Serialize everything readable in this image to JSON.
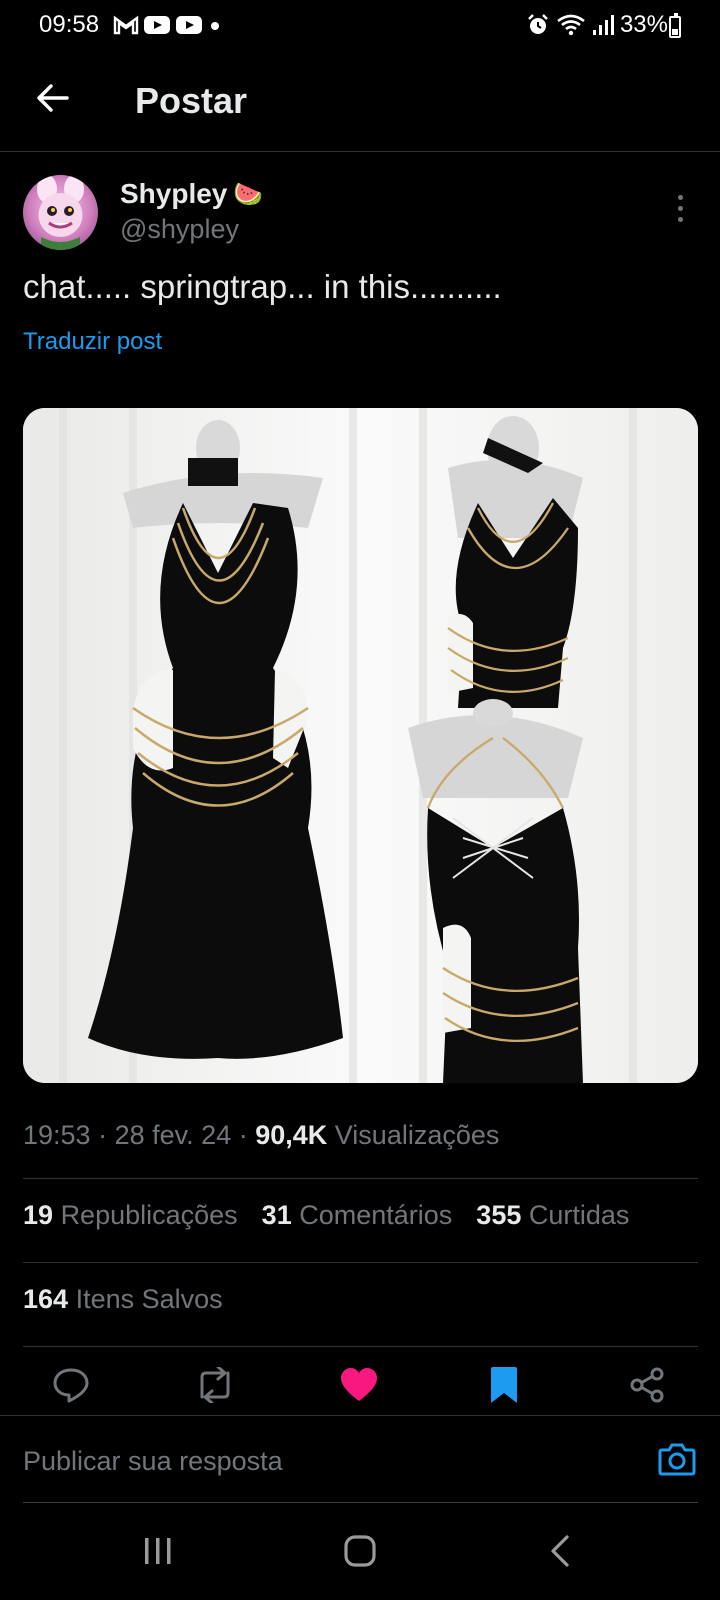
{
  "status_bar": {
    "time": "09:58",
    "battery": "33%"
  },
  "header": {
    "title": "Postar"
  },
  "post": {
    "author_name": "Shypley",
    "author_emoji": "🍉",
    "author_handle": "@shypley",
    "text": "chat..... springtrap... in this..........",
    "translate": "Traduzir post",
    "time": "19:53",
    "date": "28 fev. 24",
    "views_count": "90,4K",
    "views_label": "Visualizações",
    "reposts_count": "19",
    "reposts_label": "Republicações",
    "comments_count": "31",
    "comments_label": "Comentários",
    "likes_count": "355",
    "likes_label": "Curtidas",
    "saves_count": "164",
    "saves_label": "Itens Salvos"
  },
  "reply": {
    "placeholder": "Publicar sua resposta"
  },
  "colors": {
    "accent": "#1d9bf0",
    "like": "#f91880",
    "background": "#000000"
  }
}
